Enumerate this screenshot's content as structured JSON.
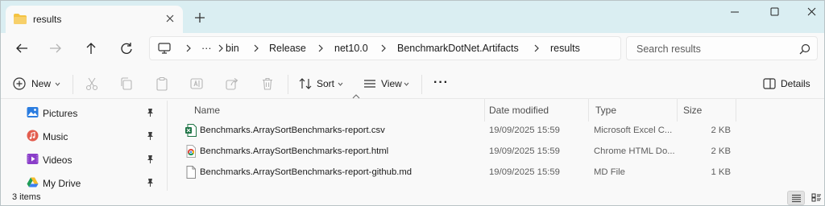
{
  "titlebar": {
    "tab_title": "results",
    "tab_icon": "folder-icon",
    "folder_color": "#f4c342",
    "bar_color": "#daeef2"
  },
  "nav": {
    "breadcrumb": [
      "bin",
      "Release",
      "net10.0",
      "BenchmarkDotNet.Artifacts",
      "results"
    ],
    "overflow_label": "···",
    "search_placeholder": "Search results"
  },
  "commandbar": {
    "new_label": "New",
    "sort_label": "Sort",
    "view_label": "View",
    "more_label": "···",
    "details_label": "Details"
  },
  "sidebar": {
    "items": [
      {
        "label": "Pictures",
        "icon": "pictures-icon",
        "pinned": true
      },
      {
        "label": "Music",
        "icon": "music-icon",
        "pinned": true
      },
      {
        "label": "Videos",
        "icon": "videos-icon",
        "pinned": true
      },
      {
        "label": "My Drive",
        "icon": "google-drive-icon",
        "pinned": true
      }
    ]
  },
  "filelist": {
    "columns": [
      "Name",
      "Date modified",
      "Type",
      "Size"
    ],
    "rows": [
      {
        "name": "Benchmarks.ArraySortBenchmarks-report.csv",
        "date": "19/09/2025 15:59",
        "type": "Microsoft Excel C...",
        "size": "2 KB",
        "icon": "excel-file-icon"
      },
      {
        "name": "Benchmarks.ArraySortBenchmarks-report.html",
        "date": "19/09/2025 15:59",
        "type": "Chrome HTML Do...",
        "size": "2 KB",
        "icon": "chrome-file-icon"
      },
      {
        "name": "Benchmarks.ArraySortBenchmarks-report-github.md",
        "date": "19/09/2025 15:59",
        "type": "MD File",
        "size": "1 KB",
        "icon": "text-file-icon"
      }
    ]
  },
  "status": {
    "item_count": "3 items"
  }
}
